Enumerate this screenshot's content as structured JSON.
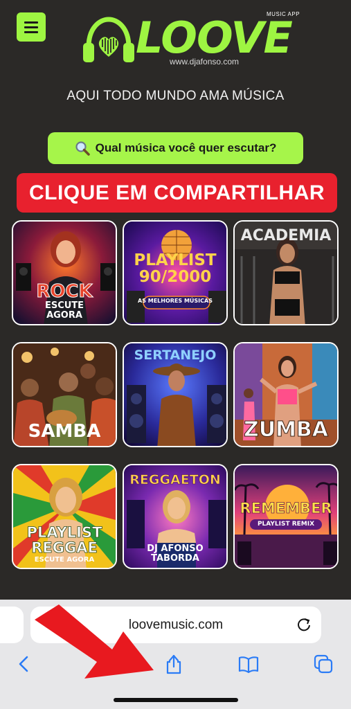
{
  "header": {
    "menu_icon": "hamburger-menu-icon",
    "logo_word": "LOOVE",
    "logo_app": "MUSIC APP",
    "logo_url": "www.djafonso.com",
    "logo_icon": "headphones-heart-icon"
  },
  "tagline": "AQUI TODO MUNDO AMA MÚSICA",
  "search": {
    "icon": "magnifier-icon",
    "label": "Qual música você quer escutar?"
  },
  "share_banner": "CLIQUE EM COMPARTILHAR",
  "colors": {
    "accent": "#9ef542",
    "banner": "#e8212e",
    "background": "#2b2927"
  },
  "playlists": [
    {
      "title": "ROCK",
      "subtitle": "ESCUTE\nAGORA"
    },
    {
      "title": "PLAYLIST\n90/2000",
      "subtitle": "AS MELHORES MÚSICAS"
    },
    {
      "title": "ACADEMIA",
      "subtitle": ""
    },
    {
      "title": "SAMBA",
      "subtitle": ""
    },
    {
      "title": "SERTANEJO",
      "subtitle": ""
    },
    {
      "title": "ZUMBA",
      "subtitle": ""
    },
    {
      "title": "PLAYLIST\nREGGAE",
      "subtitle": "ESCUTE AGORA"
    },
    {
      "title": "REGGAETON",
      "subtitle": "DJ AFONSO\nTABORDA"
    },
    {
      "title": "REMEMBER",
      "subtitle": "PLAYLIST REMIX"
    }
  ],
  "browser": {
    "url": "loovemusic.com",
    "icons": [
      "back-chevron-icon",
      "share-icon",
      "bookmarks-book-icon",
      "tabs-icon",
      "reload-icon"
    ]
  }
}
